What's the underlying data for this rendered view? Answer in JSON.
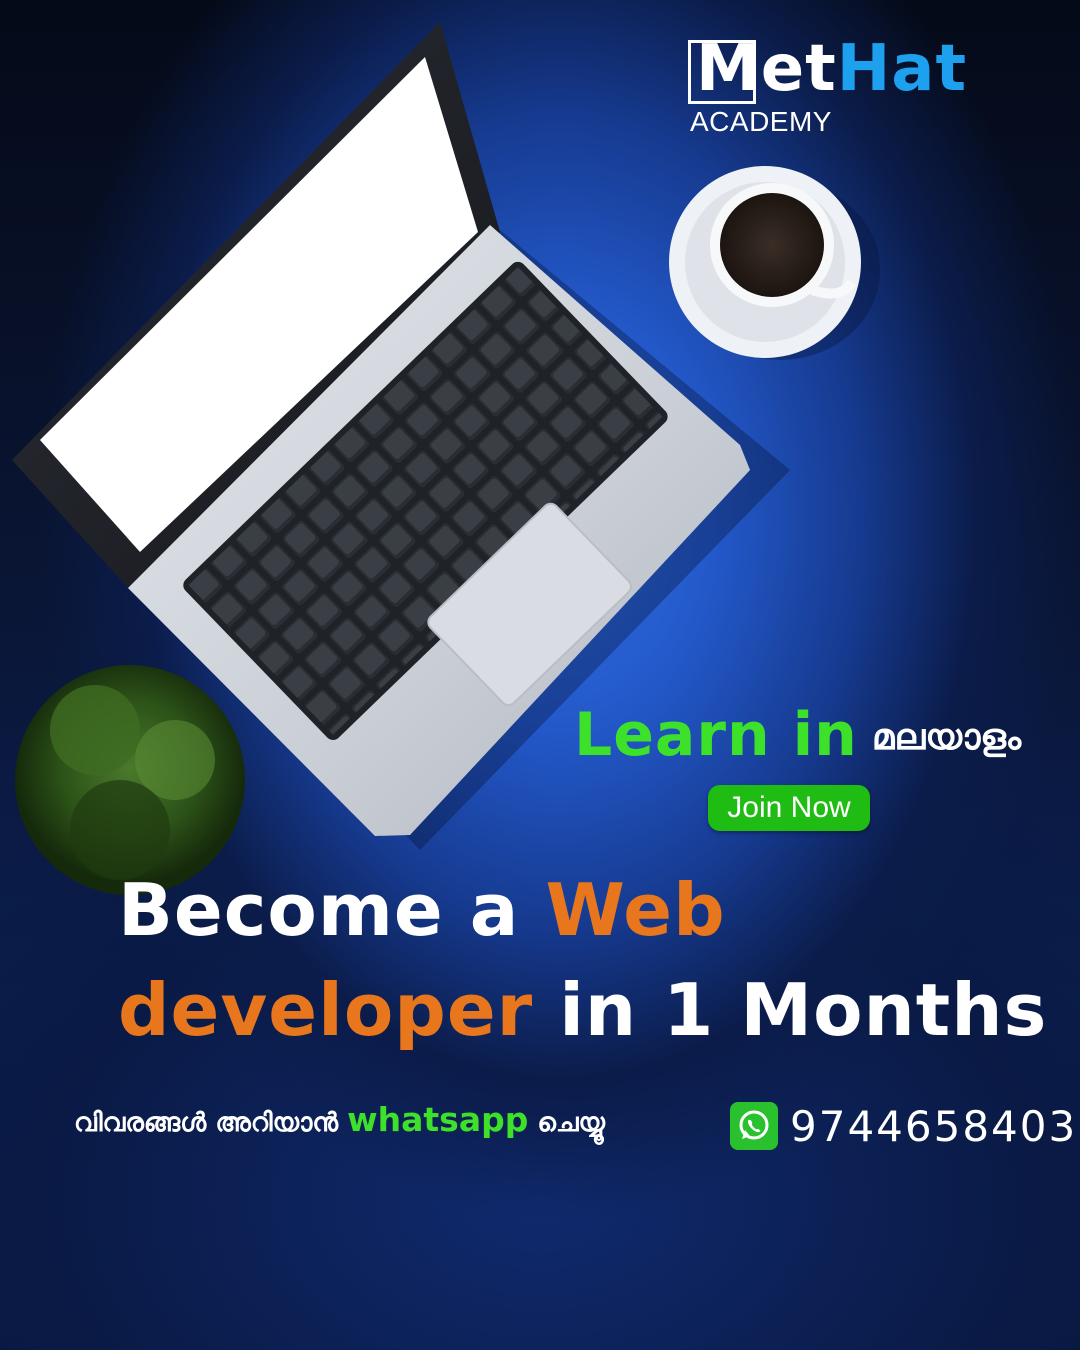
{
  "brand": {
    "name_part1": "Met",
    "name_part2": "Hat",
    "subtitle": "ACADEMY"
  },
  "promo": {
    "learn_en": "Learn in",
    "learn_ml": "മലയാളം",
    "join_label": "Join Now"
  },
  "headline": {
    "w1": "Become a",
    "w2": "Web",
    "w3": "developer",
    "w4": "in 1 Months"
  },
  "contact": {
    "text_pre": "വിവരങ്ങൾ അറിയാൻ",
    "whatsapp_word": "whatsapp",
    "text_post": "ചെയ്യൂ",
    "phone": "9744658403",
    "icon": "whatsapp-icon"
  },
  "colors": {
    "accent_green": "#3ee12a",
    "accent_orange": "#e8761d",
    "brand_blue": "#1da1ef",
    "button_green": "#1fbd14"
  }
}
